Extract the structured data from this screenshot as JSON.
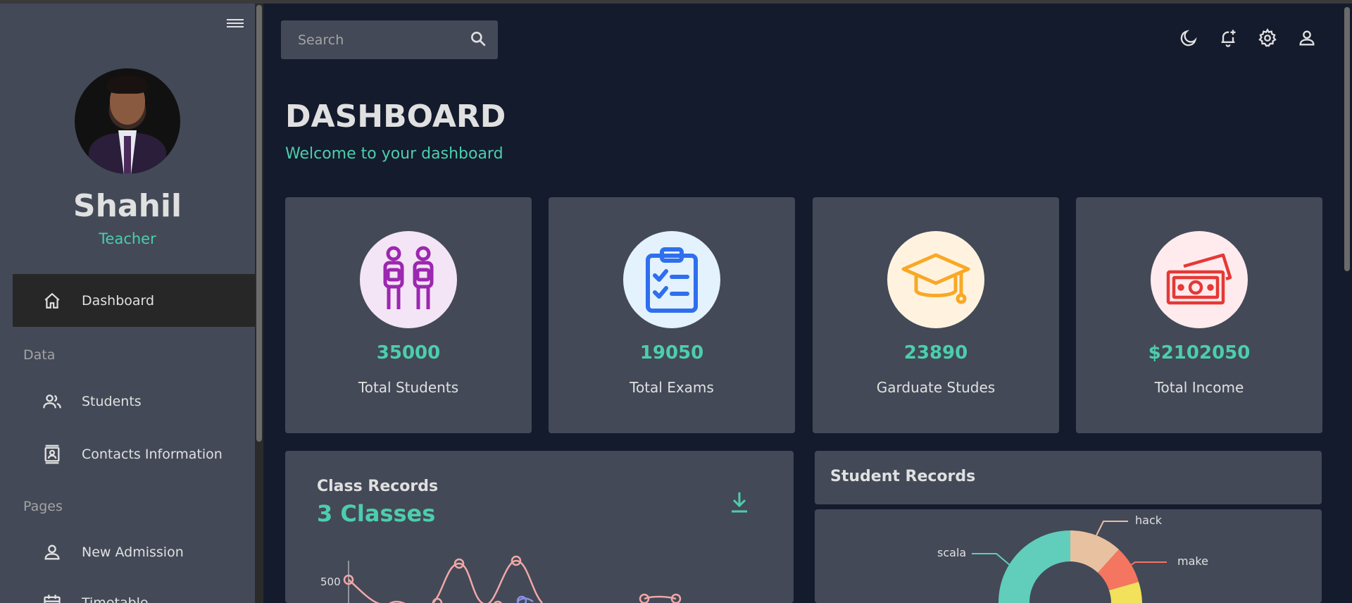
{
  "sidebar": {
    "user": {
      "name": "Shahil",
      "role": "Teacher"
    },
    "items": [
      {
        "label": "Dashboard",
        "icon": "home-icon",
        "active": true
      },
      {
        "label": "Students",
        "icon": "people-icon"
      },
      {
        "label": "Contacts Information",
        "icon": "contacts-icon"
      },
      {
        "label": "New Admission",
        "icon": "person-icon"
      },
      {
        "label": "Timetable",
        "icon": "calendar-icon"
      }
    ],
    "sections": [
      "Data",
      "Pages"
    ]
  },
  "topbar": {
    "search_placeholder": "Search",
    "icons": [
      "dark-mode-icon",
      "notification-add-icon",
      "settings-icon",
      "user-icon"
    ]
  },
  "header": {
    "title": "DASHBOARD",
    "subtitle": "Welcome to your dashboard"
  },
  "stats": [
    {
      "value": "35000",
      "label": "Total Students",
      "icon": "students-icon",
      "bg": "#f3e5f5",
      "color": "#9c27b0"
    },
    {
      "value": "19050",
      "label": "Total Exams",
      "icon": "clipboard-icon",
      "bg": "#e3f2fd",
      "color": "#2f6fed"
    },
    {
      "value": "23890",
      "label": "Garduate Studes",
      "icon": "graduation-cap-icon",
      "bg": "#fff3e0",
      "color": "#f9a825"
    },
    {
      "value": "$2102050",
      "label": "Total Income",
      "icon": "money-icon",
      "bg": "#ffebee",
      "color": "#e53935"
    }
  ],
  "class_records": {
    "title": "Class Records",
    "value": "3 Classes",
    "y_tick": "500"
  },
  "student_records": {
    "title": "Student Records",
    "labels": [
      "hack",
      "scala",
      "make"
    ]
  },
  "colors": {
    "accent": "#4cceac",
    "bg": "#141b2d",
    "panel": "#434957"
  }
}
